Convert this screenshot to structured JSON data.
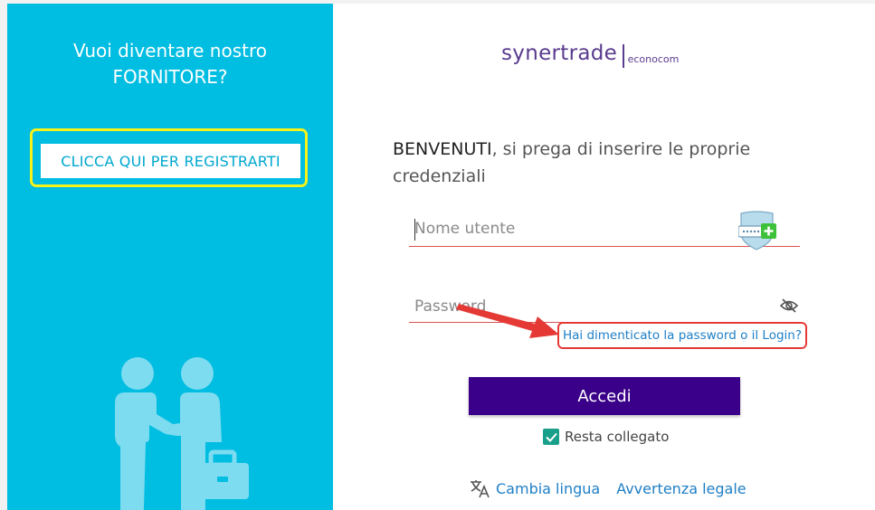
{
  "left_panel": {
    "title_line1": "Vuoi diventare nostro",
    "title_line2": "FORNITORE?",
    "register_label": "CLICCA QUI PER REGISTRARTI"
  },
  "logo": {
    "brand": "synertrade",
    "sub": "econocom"
  },
  "welcome": {
    "bold": "BENVENUTI",
    "rest": ", si prega di inserire le proprie credenziali"
  },
  "form": {
    "username_placeholder": "Nome utente",
    "password_placeholder": "Password",
    "forgot_link": "Hai dimenticato la password o il Login?",
    "login_label": "Accedi",
    "remember_label": "Resta collegato",
    "remember_checked": true
  },
  "footer": {
    "language_link": "Cambia lingua",
    "legal_link": "Avvertenza legale"
  },
  "colors": {
    "left_bg": "#00bde2",
    "highlight_yellow": "#f7f21a",
    "brand_purple": "#5a3b8f",
    "button_purple": "#3a0089",
    "link_blue": "#1e7fc6",
    "annotation_red": "#e53935",
    "checkbox_green": "#1aa08a"
  },
  "icons": {
    "password_manager": "password-manager-icon",
    "eye": "eye-slash-icon",
    "translate": "translate-icon",
    "checkbox": "checkmark-icon"
  }
}
